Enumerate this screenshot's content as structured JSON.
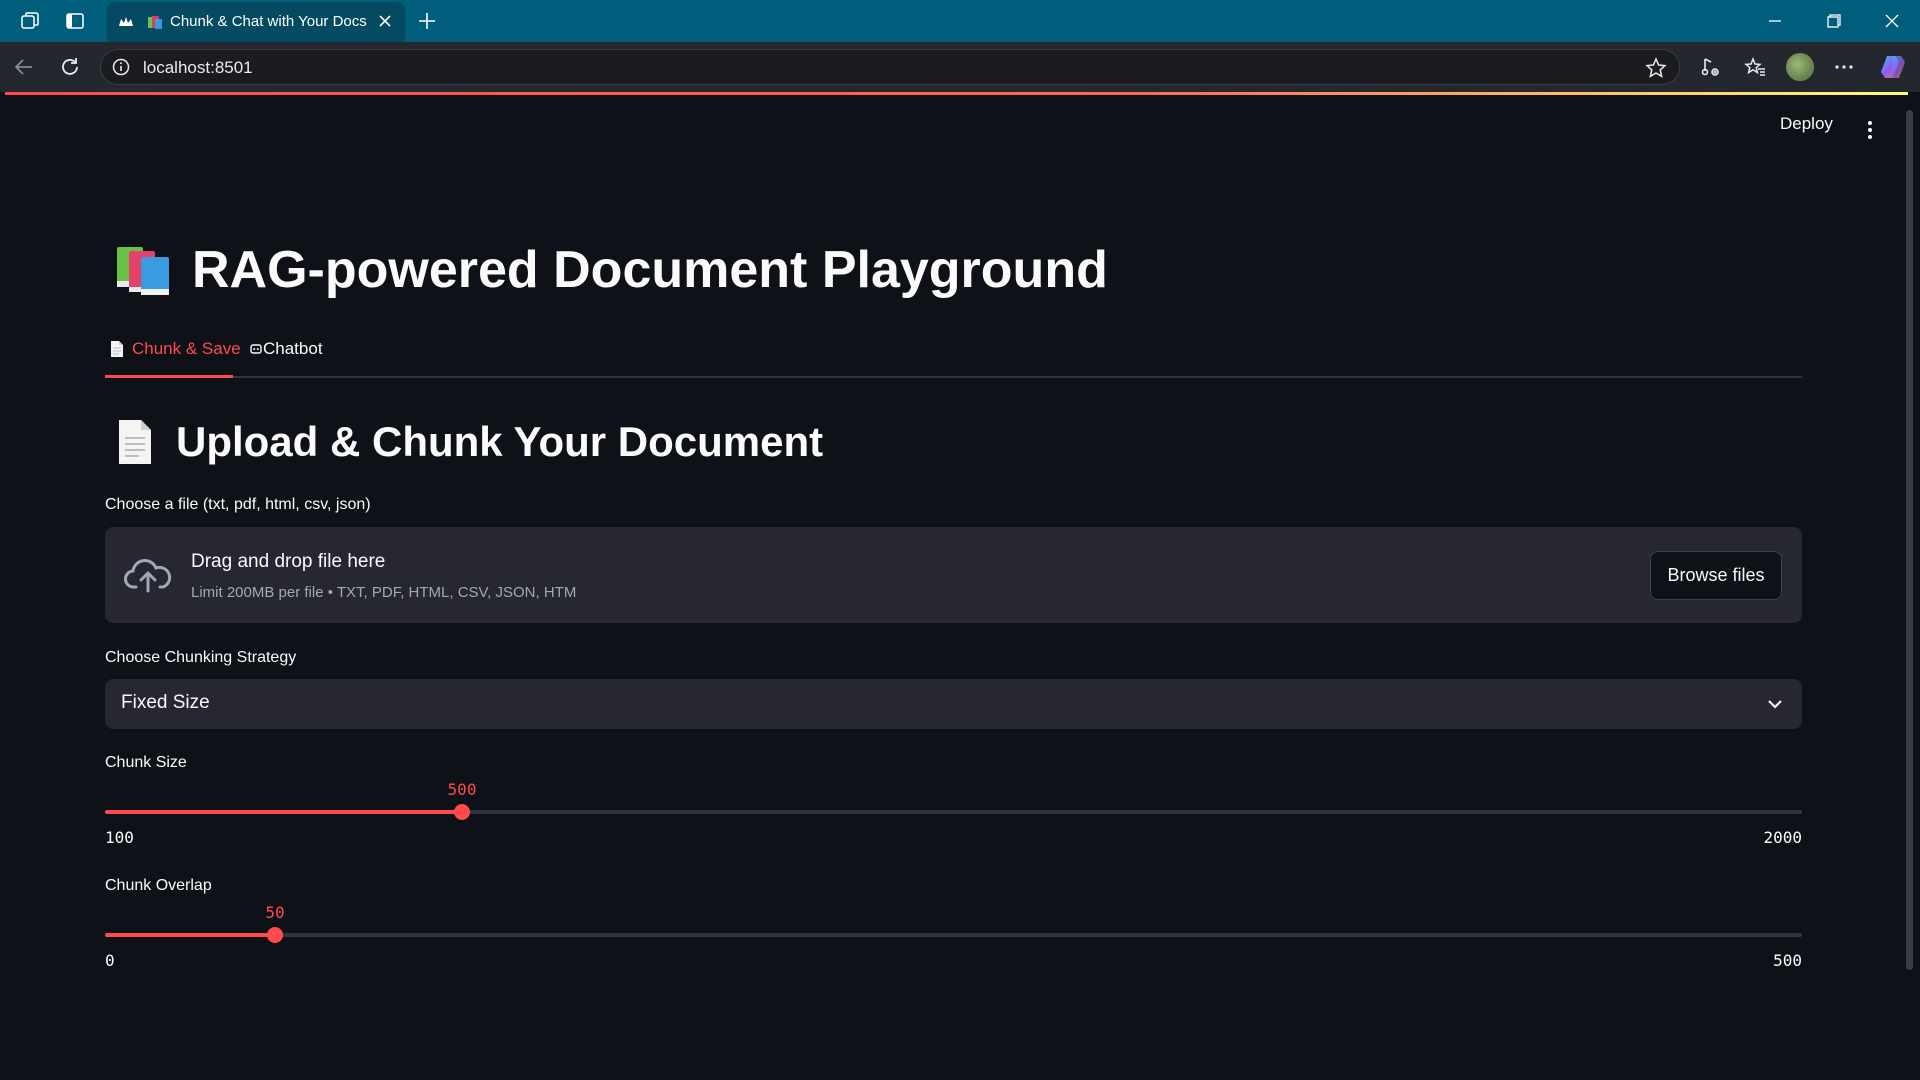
{
  "browser": {
    "tab_title": "Chunk & Chat with Your Docs",
    "url": "localhost:8501",
    "icons": {
      "workspaces": "workspaces-icon",
      "tab_actions": "tab-actions-icon",
      "favicon": "streamlit-crown-icon",
      "close": "close-icon",
      "new_tab": "plus-icon",
      "minimize": "minimize-icon",
      "restore": "restore-icon",
      "close_window": "close-window-icon",
      "back": "back-arrow-icon",
      "refresh": "refresh-icon",
      "info": "info-icon",
      "favorite": "star-icon",
      "read_aloud": "read-aloud-icon",
      "favorites": "favorites-icon",
      "profile": "avatar",
      "more": "more-icon",
      "copilot": "copilot-icon"
    }
  },
  "header": {
    "deploy_label": "Deploy"
  },
  "page": {
    "title": "RAG-powered Document Playground",
    "title_icon": "books-emoji-icon",
    "tabs": [
      {
        "label": "Chunk & Save",
        "icon": "page-facing-up-icon",
        "active": true
      },
      {
        "label": "Chatbot",
        "icon": "robot-icon",
        "active": false
      }
    ],
    "section_title": "Upload & Chunk Your Document",
    "section_icon": "page-facing-up-icon"
  },
  "uploader": {
    "label": "Choose a file (txt, pdf, html, csv, json)",
    "drop_title": "Drag and drop file here",
    "drop_subtitle": "Limit 200MB per file • TXT, PDF, HTML, CSV, JSON, HTM",
    "browse_label": "Browse files",
    "icon": "cloud-upload-icon"
  },
  "strategy": {
    "label": "Choose Chunking Strategy",
    "value": "Fixed Size"
  },
  "sliders": {
    "chunk_size": {
      "label": "Chunk Size",
      "value": "500",
      "min": "100",
      "max": "2000",
      "fraction": 0.2105
    },
    "chunk_overlap": {
      "label": "Chunk Overlap",
      "value": "50",
      "min": "0",
      "max": "500",
      "fraction": 0.1
    }
  },
  "colors": {
    "accent": "#ff4b4b",
    "background": "#0e1117",
    "surface": "#262730",
    "browser_tabbar": "#005e7c"
  }
}
